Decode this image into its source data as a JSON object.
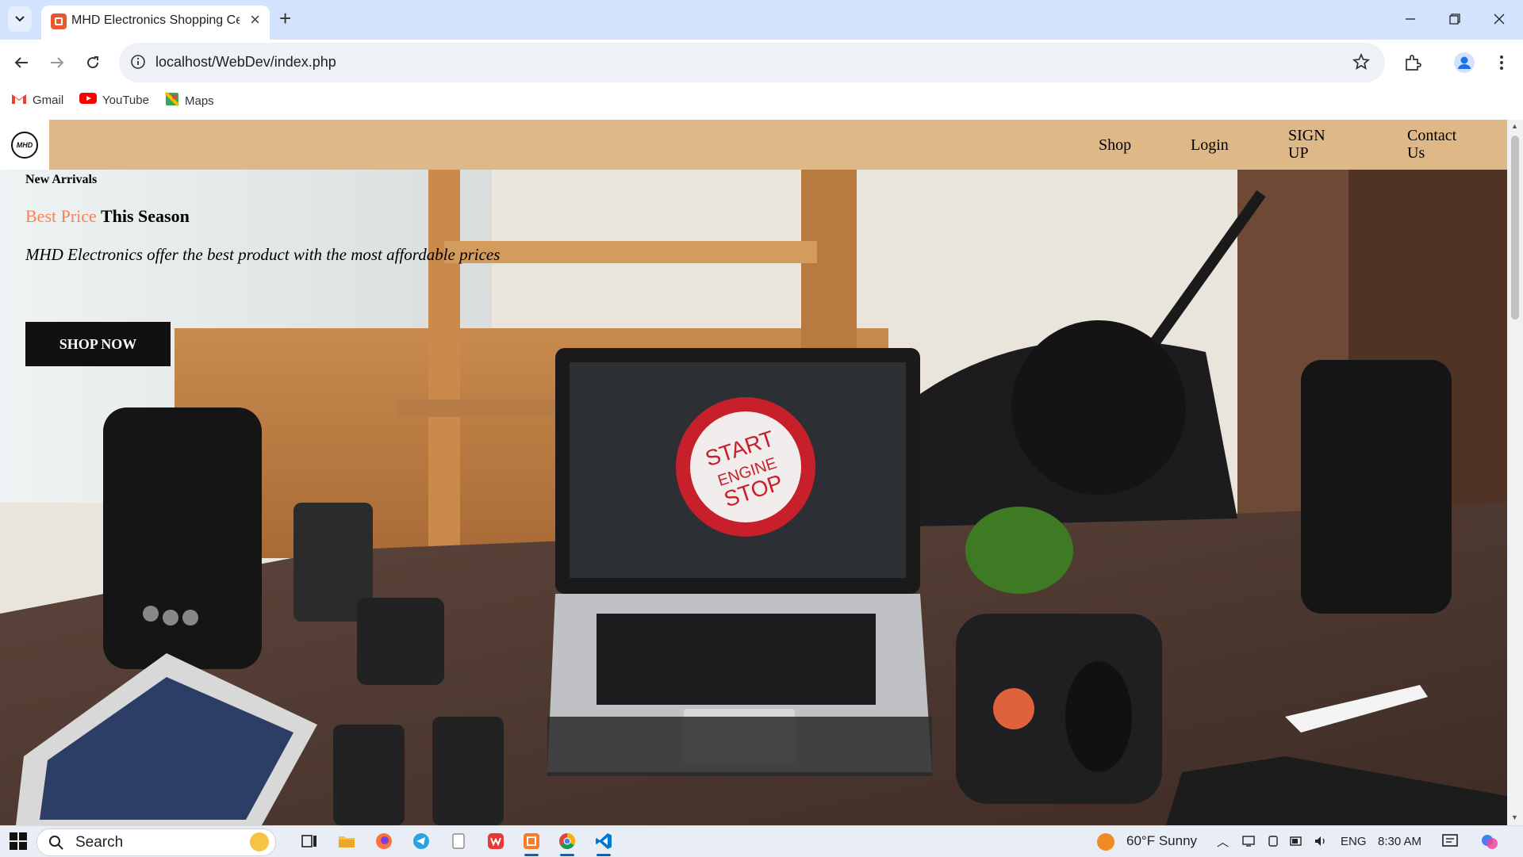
{
  "browser": {
    "tab_title": "MHD Electronics Shopping Cen",
    "url": "localhost/WebDev/index.php",
    "bookmarks": [
      {
        "label": "Gmail",
        "icon": "gmail-icon"
      },
      {
        "label": "YouTube",
        "icon": "youtube-icon"
      },
      {
        "label": "Maps",
        "icon": "maps-icon"
      }
    ]
  },
  "site": {
    "logo_text": "MHD",
    "nav": {
      "shop": "Shop",
      "login": "Login",
      "signup": "SIGN UP",
      "contact": "Contact Us"
    },
    "hero": {
      "kicker": "New Arrivals",
      "headline_accent": "Best Price",
      "headline_rest": "This Season",
      "tagline": "MHD Electronics offer the best product with the most affordable prices",
      "cta": "SHOP NOW"
    },
    "colors": {
      "header_bg": "#deb887",
      "accent": "#ff7f50",
      "button_bg": "#111111"
    }
  },
  "taskbar": {
    "search_label": "Search",
    "weather": "60°F Sunny",
    "language": "ENG",
    "time": "8:30 AM"
  }
}
